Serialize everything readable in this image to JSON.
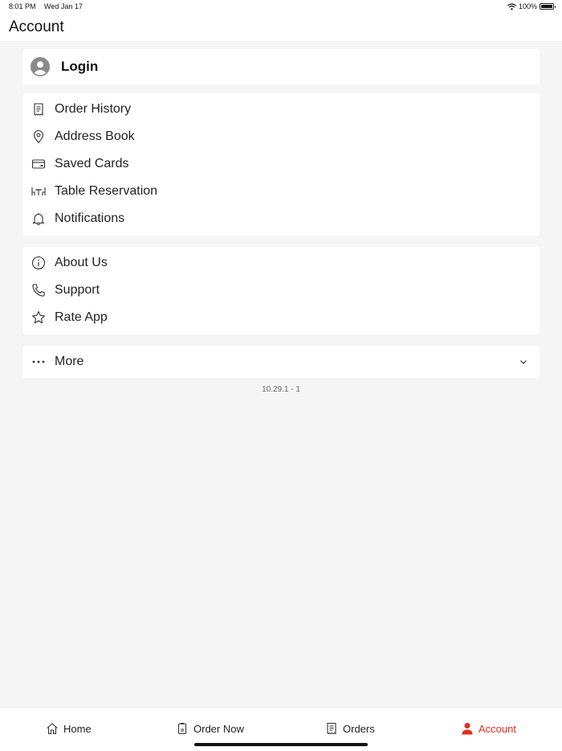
{
  "status_bar": {
    "time": "8:01 PM",
    "date": "Wed Jan 17",
    "battery": "100%"
  },
  "header": {
    "title": "Account"
  },
  "login": {
    "label": "Login"
  },
  "section1": [
    {
      "label": "Order History",
      "icon": "receipt-icon"
    },
    {
      "label": "Address Book",
      "icon": "location-pin-icon"
    },
    {
      "label": "Saved Cards",
      "icon": "credit-card-icon"
    },
    {
      "label": "Table Reservation",
      "icon": "table-icon"
    },
    {
      "label": "Notifications",
      "icon": "bell-icon"
    }
  ],
  "section2": [
    {
      "label": "About Us",
      "icon": "info-icon"
    },
    {
      "label": "Support",
      "icon": "phone-icon"
    },
    {
      "label": "Rate App",
      "icon": "star-icon"
    }
  ],
  "more": {
    "label": "More"
  },
  "version": "10.29.1 - 1",
  "tabs": [
    {
      "label": "Home",
      "icon": "home-icon"
    },
    {
      "label": "Order Now",
      "icon": "order-now-icon"
    },
    {
      "label": "Orders",
      "icon": "orders-icon"
    },
    {
      "label": "Account",
      "icon": "account-icon",
      "active": true
    }
  ],
  "colors": {
    "accent": "#e32d20",
    "background": "#f5f5f5",
    "card": "#ffffff"
  }
}
